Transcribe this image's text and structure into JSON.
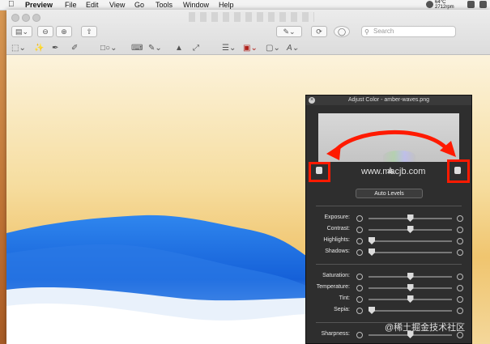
{
  "menubar": {
    "app": "Preview",
    "items": [
      "File",
      "Edit",
      "View",
      "Go",
      "Tools",
      "Window",
      "Help"
    ],
    "weather_temp": "64°C",
    "weather_rpm": "2712rpm"
  },
  "toolbar": {
    "search_placeholder": "Search"
  },
  "panel": {
    "title": "Adjust Color - amber-waves.png",
    "auto_levels": "Auto Levels",
    "sliders": [
      {
        "label": "Exposure:",
        "value": 0.5
      },
      {
        "label": "Contrast:",
        "value": 0.5
      },
      {
        "label": "Highlights:",
        "value": 0.0
      },
      {
        "label": "Shadows:",
        "value": 0.0
      },
      {
        "label": "Saturation:",
        "value": 0.5
      },
      {
        "label": "Temperature:",
        "value": 0.5
      },
      {
        "label": "Tint:",
        "value": 0.5
      },
      {
        "label": "Sepia:",
        "value": 0.0
      },
      {
        "label": "Sharpness:",
        "value": 0.5
      }
    ]
  },
  "watermarks": {
    "site": "www.macjb.com",
    "juejin": "@稀土掘金技术社区"
  },
  "colors": {
    "annotation_red": "#ff1a00",
    "panel_bg": "#2e2e2e",
    "sky_top": "#fcf3dc",
    "wave_blue": "#1a6fe0"
  }
}
